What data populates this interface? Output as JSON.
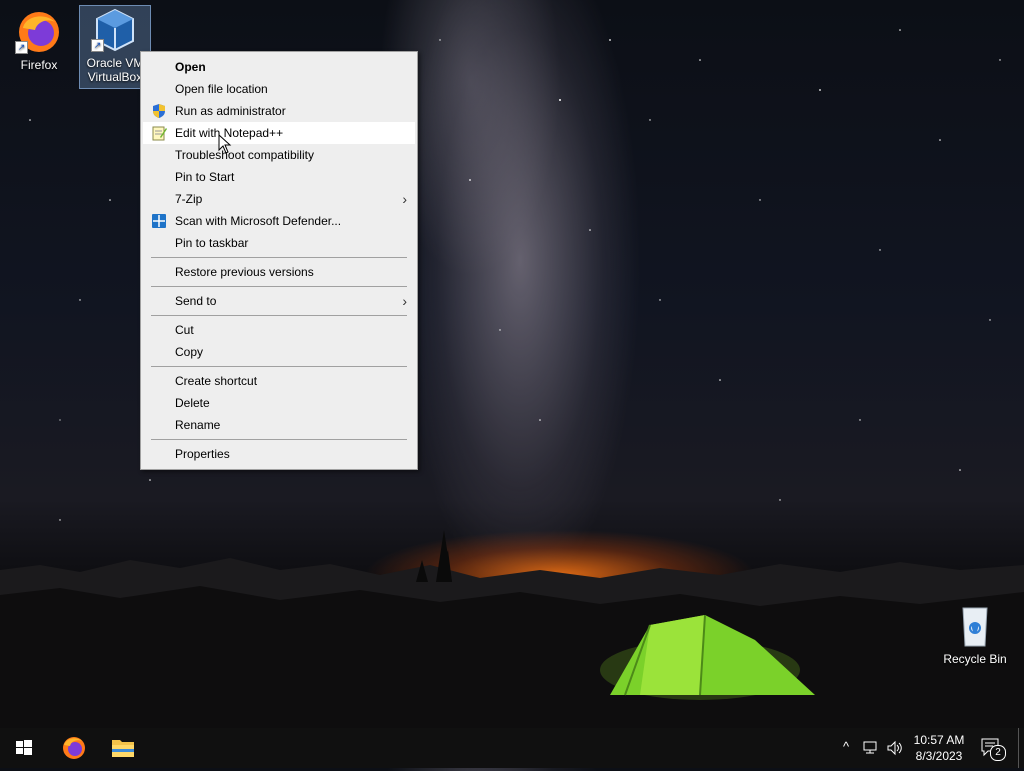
{
  "desktop": {
    "icons": [
      {
        "label": "Firefox",
        "icon": "firefox-icon"
      },
      {
        "label_line1": "Oracle VM",
        "label_line2": "VirtualBox",
        "icon": "virtualbox-icon"
      },
      {
        "label": "Recycle Bin",
        "icon": "recycle-bin-icon"
      }
    ]
  },
  "context_menu": {
    "items": [
      {
        "label": "Open",
        "bold": true
      },
      {
        "label": "Open file location"
      },
      {
        "label": "Run as administrator",
        "icon": "shield-icon"
      },
      {
        "label": "Edit with Notepad++",
        "icon": "notepad-plus-plus-icon",
        "hovered": true
      },
      {
        "label": "Troubleshoot compatibility"
      },
      {
        "label": "Pin to Start"
      },
      {
        "label": "7-Zip",
        "submenu": true
      },
      {
        "label": "Scan with Microsoft Defender...",
        "icon": "defender-icon"
      },
      {
        "label": "Pin to taskbar"
      },
      {
        "label": "Restore previous versions"
      },
      {
        "label": "Send to",
        "submenu": true
      },
      {
        "label": "Cut"
      },
      {
        "label": "Copy"
      },
      {
        "label": "Create shortcut"
      },
      {
        "label": "Delete"
      },
      {
        "label": "Rename"
      },
      {
        "label": "Properties"
      }
    ],
    "submenu_arrow": "›"
  },
  "taskbar": {
    "pinned": [
      "start-icon",
      "firefox-icon",
      "file-explorer-icon"
    ],
    "clock_time": "10:57 AM",
    "clock_date": "8/3/2023",
    "notification_count": "2",
    "chevron": "^",
    "colors": {
      "background": "#101010",
      "accent": "#0078d7"
    }
  }
}
